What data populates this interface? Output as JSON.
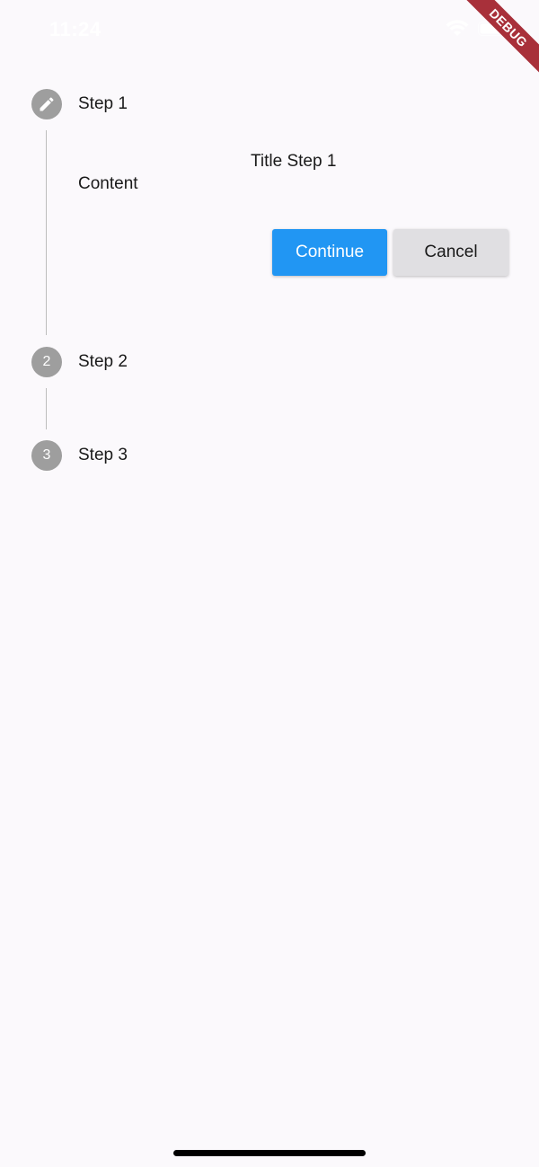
{
  "status_bar": {
    "time": "11:24"
  },
  "debug_banner": {
    "label": "DEBUG",
    "color": "#a8303a"
  },
  "stepper": {
    "steps": [
      {
        "number": "",
        "icon": "pencil-icon",
        "title": "Step 1",
        "state": "editing"
      },
      {
        "number": "2",
        "title": "Step 2",
        "state": "indexed"
      },
      {
        "number": "3",
        "title": "Step 3",
        "state": "indexed"
      }
    ],
    "active_content": {
      "title": "Title Step 1",
      "body": "Content"
    },
    "controls": {
      "continue_label": "Continue",
      "cancel_label": "Cancel"
    }
  },
  "colors": {
    "background": "#fbf9fc",
    "step_circle": "#9e9e9e",
    "continue_button": "#2196f3",
    "cancel_button": "#e0dfe2"
  }
}
